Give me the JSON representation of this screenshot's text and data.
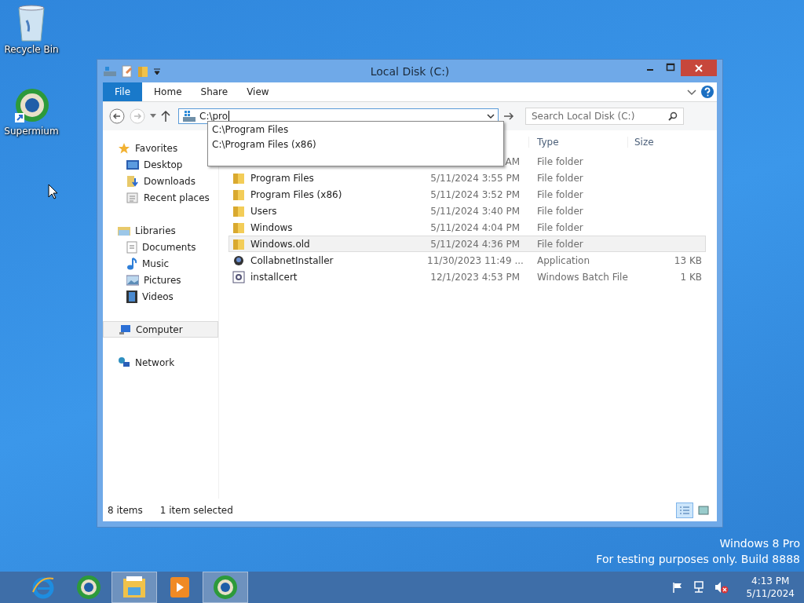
{
  "desktop_icons": [
    {
      "label": "Recycle Bin",
      "kind": "bin"
    },
    {
      "label": "Supermium",
      "kind": "browser"
    }
  ],
  "window": {
    "title": "Local Disk (C:)",
    "ribbon_tabs": [
      {
        "label": "File",
        "kind": "menu"
      },
      {
        "label": "Home",
        "kind": "tab"
      },
      {
        "label": "Share",
        "kind": "tab"
      },
      {
        "label": "View",
        "kind": "tab"
      }
    ],
    "address": {
      "value": "C:\\pro",
      "suggestions": [
        "C:\\Program Files",
        "C:\\Program Files (x86)"
      ]
    },
    "search": {
      "placeholder": "Search Local Disk (C:)"
    },
    "navigation": [
      {
        "label": "Favorites",
        "kind": "star",
        "selected": false,
        "children": [
          {
            "label": "Desktop",
            "kind": "desktop",
            "selected": false
          },
          {
            "label": "Downloads",
            "kind": "downloads",
            "selected": false
          },
          {
            "label": "Recent places",
            "kind": "recent",
            "selected": false
          }
        ]
      },
      {
        "label": "Libraries",
        "kind": "libraries",
        "selected": false,
        "children": [
          {
            "label": "Documents",
            "kind": "documents",
            "selected": false
          },
          {
            "label": "Music",
            "kind": "music",
            "selected": false
          },
          {
            "label": "Pictures",
            "kind": "pictures",
            "selected": false
          },
          {
            "label": "Videos",
            "kind": "videos",
            "selected": false
          }
        ]
      },
      {
        "label": "Computer",
        "kind": "computer",
        "selected": true
      },
      {
        "label": "Network",
        "kind": "network",
        "selected": false
      }
    ],
    "columns": [
      "Type",
      "Size"
    ],
    "rows": [
      {
        "date": "AM",
        "type": "File folder",
        "selected": false
      },
      {
        "kind": "folder",
        "name": "Program Files",
        "date": "5/11/2024 3:55 PM",
        "type": "File folder",
        "selected": false
      },
      {
        "kind": "folder",
        "name": "Program Files (x86)",
        "date": "5/11/2024 3:52 PM",
        "type": "File folder",
        "selected": false
      },
      {
        "kind": "folder",
        "name": "Users",
        "date": "5/11/2024 3:40 PM",
        "type": "File folder",
        "selected": false
      },
      {
        "kind": "folder",
        "name": "Windows",
        "date": "5/11/2024 4:04 PM",
        "type": "File folder",
        "selected": false
      },
      {
        "kind": "folder",
        "name": "Windows.old",
        "date": "5/11/2024 4:36 PM",
        "type": "File folder",
        "selected": true
      },
      {
        "kind": "app",
        "name": "CollabnetInstaller",
        "date": "11/30/2023 11:49 ...",
        "type": "Application",
        "size": "13 KB",
        "selected": false
      },
      {
        "kind": "batch",
        "name": "installcert",
        "date": "12/1/2023 4:53 PM",
        "type": "Windows Batch File",
        "size": "1 KB",
        "selected": false
      }
    ],
    "status_bar": {
      "item_count": "8 items",
      "selection": "1 item selected",
      "views": [
        {
          "kind": "details",
          "selected": true
        },
        {
          "kind": "tiles",
          "selected": false
        }
      ]
    }
  },
  "os_notice": [
    "Windows 8 Pro",
    "For testing purposes only. Build 8888"
  ],
  "taskbar": {
    "apps": [
      {
        "kind": "ie",
        "active": false
      },
      {
        "kind": "browser",
        "active": false
      },
      {
        "kind": "explorer",
        "active": true
      },
      {
        "kind": "media",
        "active": false
      },
      {
        "kind": "browser",
        "active": true
      }
    ],
    "clock": {
      "time": "4:13 PM",
      "date": "5/11/2024"
    }
  }
}
